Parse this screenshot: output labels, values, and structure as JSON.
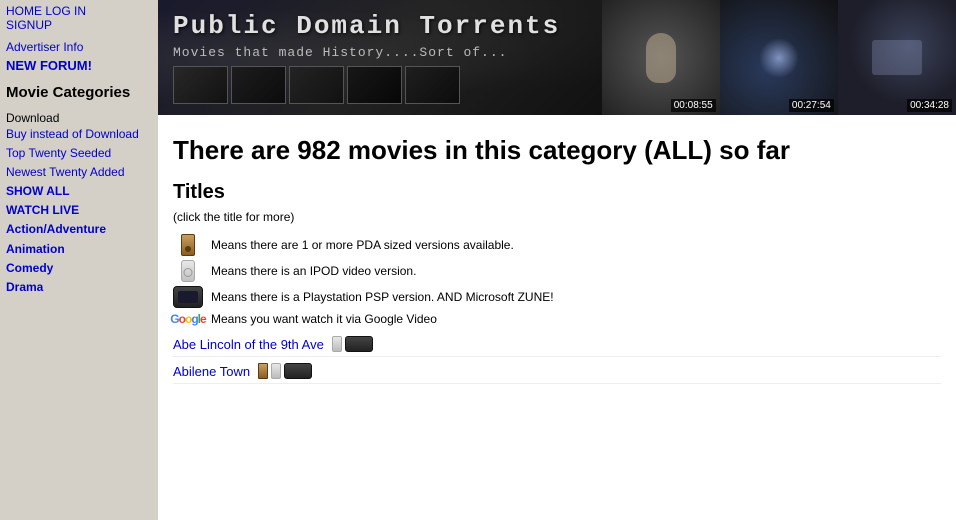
{
  "sidebar": {
    "top_links": {
      "home": "HOME",
      "login": "LOG IN",
      "signup": "SIGNUP"
    },
    "advertiser_info": "Advertiser Info",
    "new_forum": "NEW FORUM!",
    "movie_categories_heading": "Movie Categories",
    "download_label": "Download",
    "nav_items": [
      {
        "label": "Buy instead of Download",
        "bold": false
      },
      {
        "label": "Top Twenty Seeded",
        "bold": false
      },
      {
        "label": "Newest Twenty Added",
        "bold": false
      },
      {
        "label": "SHOW ALL",
        "bold": true
      },
      {
        "label": "WATCH LIVE",
        "bold": true
      },
      {
        "label": "Action/Adventure",
        "bold": true
      },
      {
        "label": "Animation",
        "bold": true
      },
      {
        "label": "Comedy",
        "bold": true
      },
      {
        "label": "Drama",
        "bold": true
      }
    ]
  },
  "banner": {
    "title": "Public Domain Torrents",
    "subtitle": "Movies that made History....Sort of...",
    "videos": [
      {
        "duration": "00:08:55"
      },
      {
        "duration": "00:27:54"
      },
      {
        "duration": "00:34:28"
      }
    ]
  },
  "content": {
    "page_title": "There are 982 movies in this category (ALL) so far",
    "section_title": "Titles",
    "click_hint": "(click the title for more)",
    "legend": [
      {
        "icon_type": "pda",
        "text": "Means there are 1 or more PDA sized versions available."
      },
      {
        "icon_type": "ipod",
        "text": "Means there is an IPOD video version."
      },
      {
        "icon_type": "psp",
        "text": "Means there is a Playstation PSP version. AND Microsoft ZUNE!"
      },
      {
        "icon_type": "google",
        "text": "Means you want watch it via Google Video"
      }
    ],
    "movies": [
      {
        "title": "Abe Lincoln of the 9th Ave",
        "icons": [
          "ipod",
          "psp"
        ]
      },
      {
        "title": "Abilene Town",
        "icons": [
          "pda",
          "ipod",
          "psp"
        ]
      }
    ]
  }
}
